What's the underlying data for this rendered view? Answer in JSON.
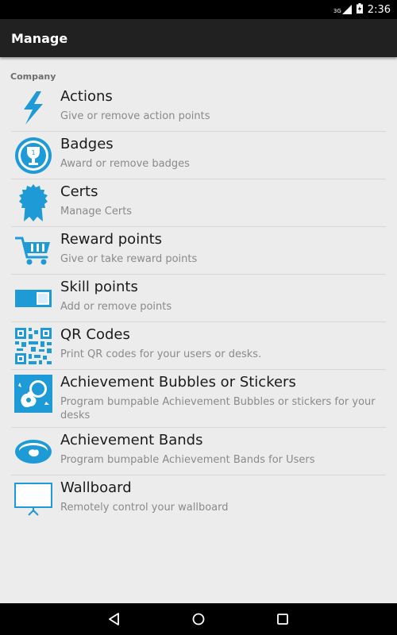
{
  "status_bar": {
    "network": "3G",
    "time": "2:36"
  },
  "app_bar": {
    "title": "Manage"
  },
  "section": {
    "header": "Company"
  },
  "items": [
    {
      "title": "Actions",
      "subtitle": "Give or remove action points",
      "icon": "lightning-bolt-icon"
    },
    {
      "title": "Badges",
      "subtitle": "Award or remove badges",
      "icon": "trophy-badge-icon"
    },
    {
      "title": "Certs",
      "subtitle": "Manage Certs",
      "icon": "certificate-rosette-icon"
    },
    {
      "title": "Reward points",
      "subtitle": "Give or take reward points",
      "icon": "shopping-cart-icon"
    },
    {
      "title": "Skill points",
      "subtitle": "Add or remove points",
      "icon": "skill-bar-icon"
    },
    {
      "title": "QR Codes",
      "subtitle": "Print QR codes for your users or desks.",
      "icon": "qr-code-icon"
    },
    {
      "title": "Achievement Bubbles or Stickers",
      "subtitle": "Program bumpable Achievement Bubbles or stickers for your desks",
      "icon": "sticker-icon"
    },
    {
      "title": "Achievement Bands",
      "subtitle": "Program bumpable Achievement Bands for Users",
      "icon": "wristband-icon"
    },
    {
      "title": "Wallboard",
      "subtitle": "Remotely control your wallboard",
      "icon": "wallboard-screen-icon"
    }
  ],
  "colors": {
    "accent": "#1e9bd7",
    "app_bar": "#212121",
    "background": "#ececec"
  }
}
